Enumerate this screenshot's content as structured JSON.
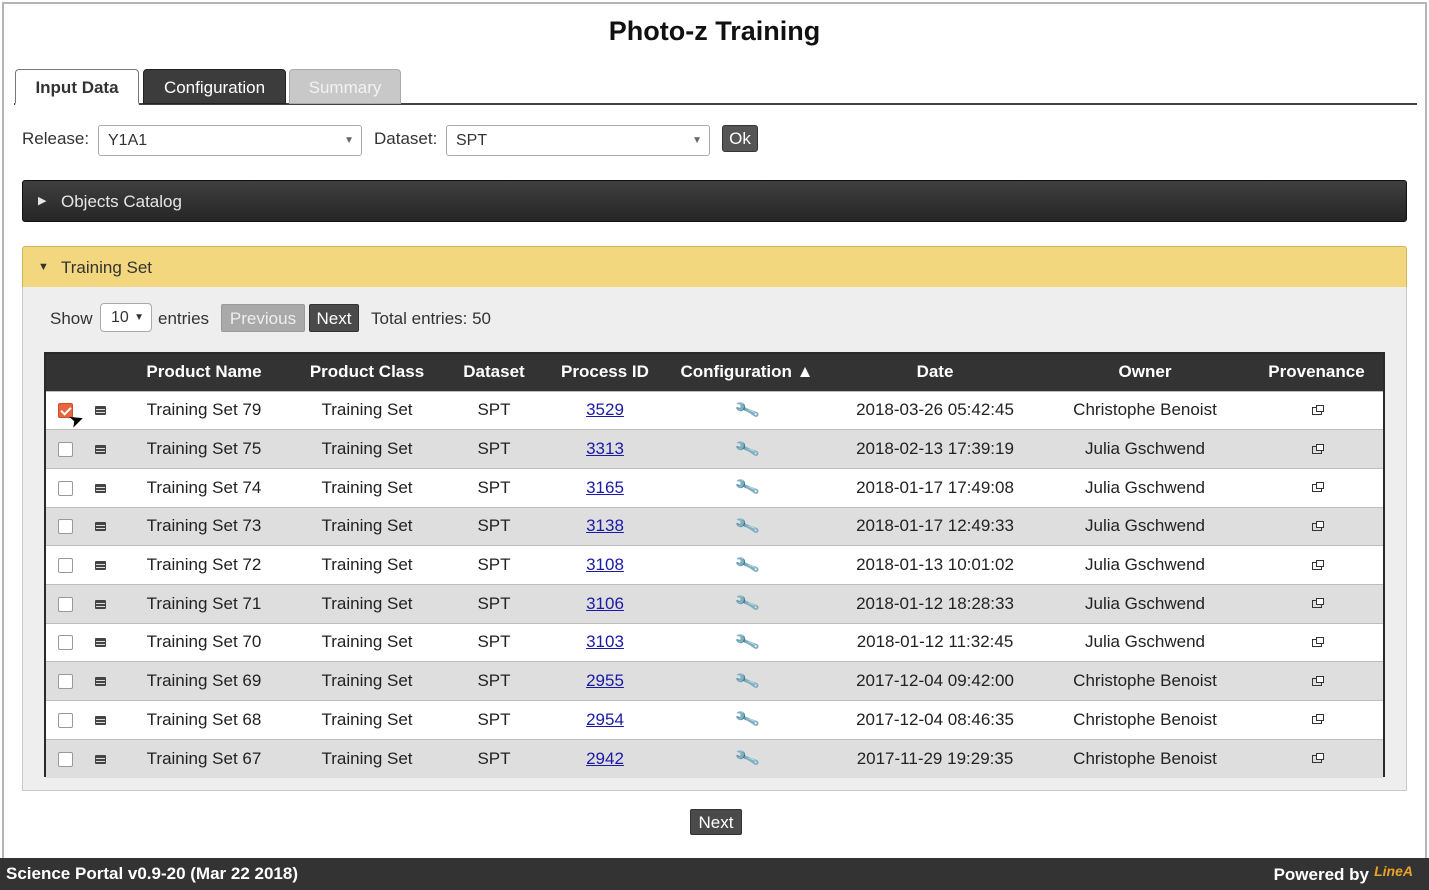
{
  "page_title": "Photo-z Training",
  "tabs": [
    {
      "label": "Input Data",
      "state": "active"
    },
    {
      "label": "Configuration",
      "state": "enabled"
    },
    {
      "label": "Summary",
      "state": "disabled"
    }
  ],
  "filters": {
    "release_label": "Release:",
    "release_value": "Y1A1",
    "dataset_label": "Dataset:",
    "dataset_value": "SPT",
    "ok_label": "Ok"
  },
  "panels": {
    "objects_catalog": "Objects Catalog",
    "training_set": "Training Set"
  },
  "pagination": {
    "show_label": "Show",
    "entries_value": "10",
    "entries_label": "entries",
    "previous_label": "Previous",
    "next_label": "Next",
    "total_entries": "Total entries: 50"
  },
  "table": {
    "columns": [
      "Product Name",
      "Product Class",
      "Dataset",
      "Process ID",
      "Configuration ▲",
      "Date",
      "Owner",
      "Provenance"
    ],
    "rows": [
      {
        "checked": true,
        "name": "Training Set 79",
        "class": "Training Set",
        "dataset": "SPT",
        "process_id": "3529",
        "date": "2018-03-26 05:42:45",
        "owner": "Christophe Benoist"
      },
      {
        "checked": false,
        "name": "Training Set 75",
        "class": "Training Set",
        "dataset": "SPT",
        "process_id": "3313",
        "date": "2018-02-13 17:39:19",
        "owner": "Julia Gschwend"
      },
      {
        "checked": false,
        "name": "Training Set 74",
        "class": "Training Set",
        "dataset": "SPT",
        "process_id": "3165",
        "date": "2018-01-17 17:49:08",
        "owner": "Julia Gschwend"
      },
      {
        "checked": false,
        "name": "Training Set 73",
        "class": "Training Set",
        "dataset": "SPT",
        "process_id": "3138",
        "date": "2018-01-17 12:49:33",
        "owner": "Julia Gschwend"
      },
      {
        "checked": false,
        "name": "Training Set 72",
        "class": "Training Set",
        "dataset": "SPT",
        "process_id": "3108",
        "date": "2018-01-13 10:01:02",
        "owner": "Julia Gschwend"
      },
      {
        "checked": false,
        "name": "Training Set 71",
        "class": "Training Set",
        "dataset": "SPT",
        "process_id": "3106",
        "date": "2018-01-12 18:28:33",
        "owner": "Julia Gschwend"
      },
      {
        "checked": false,
        "name": "Training Set 70",
        "class": "Training Set",
        "dataset": "SPT",
        "process_id": "3103",
        "date": "2018-01-12 11:32:45",
        "owner": "Julia Gschwend"
      },
      {
        "checked": false,
        "name": "Training Set 69",
        "class": "Training Set",
        "dataset": "SPT",
        "process_id": "2955",
        "date": "2017-12-04 09:42:00",
        "owner": "Christophe Benoist"
      },
      {
        "checked": false,
        "name": "Training Set 68",
        "class": "Training Set",
        "dataset": "SPT",
        "process_id": "2954",
        "date": "2017-12-04 08:46:35",
        "owner": "Christophe Benoist"
      },
      {
        "checked": false,
        "name": "Training Set 67",
        "class": "Training Set",
        "dataset": "SPT",
        "process_id": "2942",
        "date": "2017-11-29 19:29:35",
        "owner": "Christophe Benoist"
      }
    ]
  },
  "next_button": "Next",
  "footer": {
    "version": "Science Portal v0.9-20 (Mar 22 2018)",
    "powered_by": "Powered by",
    "logo_text": "LineA"
  },
  "colors": {
    "training_bar": "#f3d77e",
    "header_dark": "#333333",
    "checked_accent": "#e8663d",
    "wrench": "#d2562a"
  }
}
